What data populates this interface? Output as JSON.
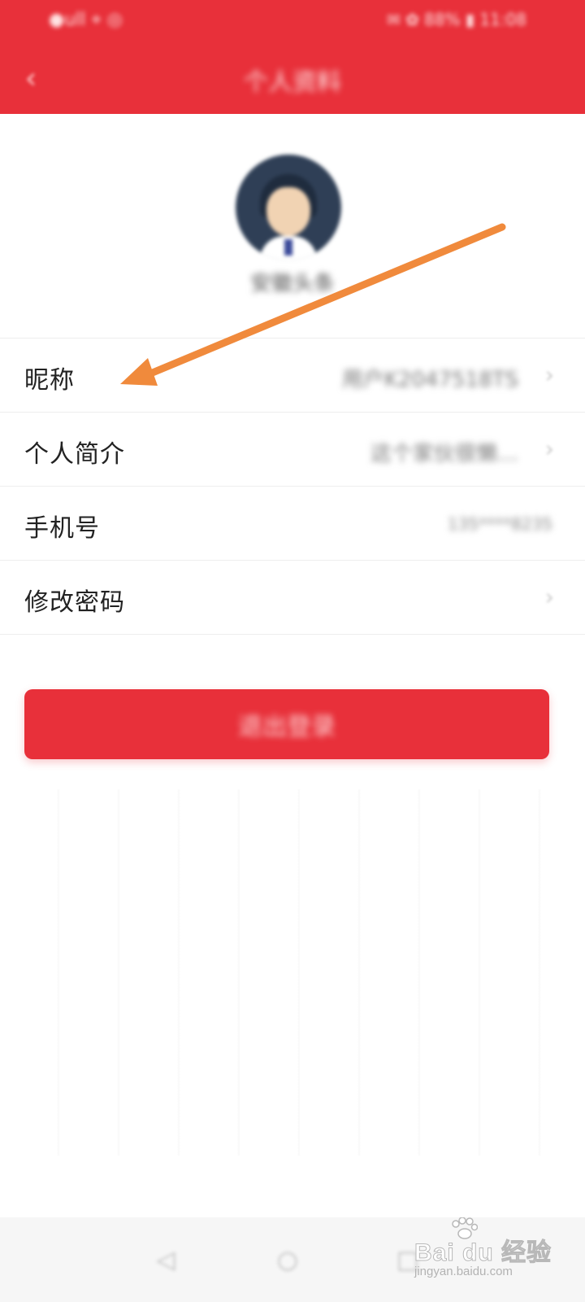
{
  "app": {
    "title": "个人资料",
    "colors": {
      "brand": "#e8303a",
      "background": "#ffffff",
      "pointer": "#f08a3c"
    }
  },
  "status_bar": {
    "left_text": "●ull ⌖ ◎",
    "right_text": "✉ ✿ 88% ▮ 11:08"
  },
  "profile": {
    "avatar_icon": "user-avatar-icon",
    "name": "安徽头条"
  },
  "settings": [
    {
      "id": "nickname",
      "label": "昵称",
      "value": "用户K2047518TS",
      "has_chevron": true
    },
    {
      "id": "bio",
      "label": "个人简介",
      "value": "这个家伙很懒…",
      "has_chevron": true
    },
    {
      "id": "phone",
      "label": "手机号",
      "value": "135****8235",
      "has_chevron": false
    },
    {
      "id": "password",
      "label": "修改密码",
      "value": "",
      "has_chevron": true
    }
  ],
  "logout_button": {
    "label": "退出登录"
  },
  "system_nav": {
    "back": "◁",
    "home": "○",
    "recent": "□"
  },
  "watermark": {
    "main": "Bai du 经验",
    "sub": "jingyan.baidu.com"
  }
}
